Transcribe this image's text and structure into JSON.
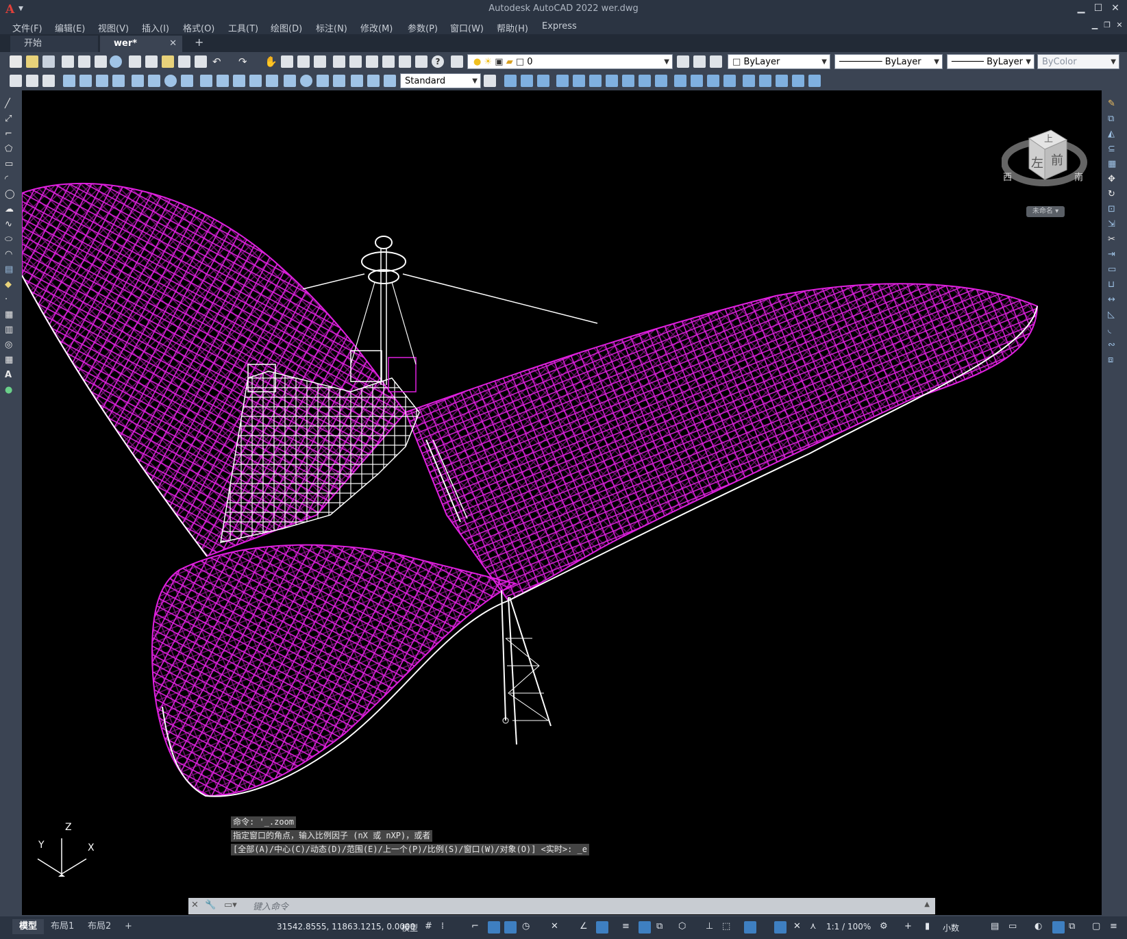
{
  "app": {
    "title": "Autodesk AutoCAD 2022    wer.dwg",
    "logo": "A"
  },
  "menu": [
    "文件(F)",
    "编辑(E)",
    "视图(V)",
    "插入(I)",
    "格式(O)",
    "工具(T)",
    "绘图(D)",
    "标注(N)",
    "修改(M)",
    "参数(P)",
    "窗口(W)",
    "帮助(H)",
    "Express"
  ],
  "tabs": {
    "start": "开始",
    "document": "wer*",
    "close": "✕",
    "add": "+"
  },
  "toolbar": {
    "layer_value": "0",
    "color_value": "ByLayer",
    "linetype_value": "ByLayer",
    "lineweight_value": "ByLayer",
    "plotstyle_value": "ByColor",
    "textstyle_value": "Standard"
  },
  "viewcube": {
    "top": "上",
    "left": "左",
    "front": "前",
    "west": "西",
    "south": "南",
    "wcs": "未命名 ▾"
  },
  "ucs": {
    "x": "X",
    "y": "Y",
    "z": "Z"
  },
  "command": {
    "history": [
      "命令: '_.zoom",
      "指定窗口的角点，输入比例因子 (nX 或 nXP)，或者",
      "[全部(A)/中心(C)/动态(D)/范围(E)/上一个(P)/比例(S)/窗口(W)/对象(O)] <实时>: _e"
    ],
    "placeholder": "键入命令"
  },
  "status": {
    "layout_tabs": [
      "模型",
      "布局1",
      "布局2"
    ],
    "add_layout": "+",
    "coordinates": "31542.8555, 11863.1215, 0.0000",
    "space": "模型",
    "scale": "1:1 / 100%",
    "units": "小数"
  },
  "colors": {
    "accent": "#3e7fc1",
    "model_primary": "#e020e0",
    "model_secondary": "#ffffff",
    "background": "#000000"
  }
}
